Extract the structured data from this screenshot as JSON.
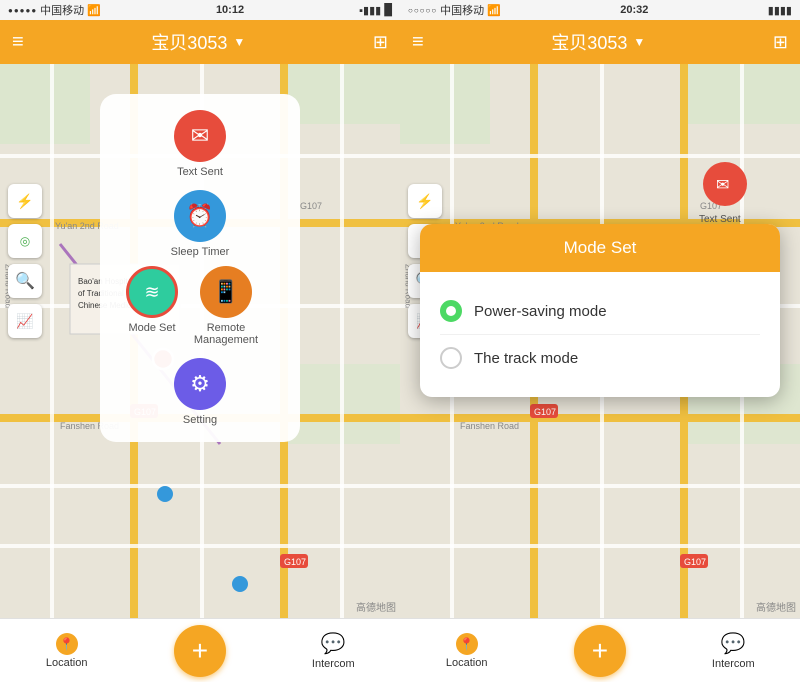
{
  "left_phone": {
    "status_bar": {
      "dots": "●●●●●",
      "carrier": "中国移动",
      "wifi": "WiFi",
      "time": "10:12",
      "battery_icon": "🔋",
      "signal": "▪▪▪▪"
    },
    "header": {
      "menu_icon": "≡",
      "title": "宝贝3053",
      "dropdown_icon": "▼",
      "grid_icon": "⊞"
    },
    "menu_items": [
      {
        "id": "text-sent",
        "label": "Text Sent",
        "color": "#e74c3c",
        "icon": "✉"
      },
      {
        "id": "sleep-timer",
        "label": "Sleep Timer",
        "color": "#3498db",
        "icon": "⏰"
      },
      {
        "id": "mode-set",
        "label": "Mode Set",
        "color": "#2ecc9e",
        "icon": "≋",
        "highlighted": true
      },
      {
        "id": "remote-management",
        "label": "Remote Management",
        "color": "#e67e22",
        "icon": "📱"
      },
      {
        "id": "setting",
        "label": "Setting",
        "color": "#6c5ce7",
        "icon": "⚙"
      }
    ],
    "map": {
      "watermark": "高德地图",
      "g107_label": "G107",
      "hospital_label": "Bao'an Hospital of Traditional Chinese Medicine"
    },
    "bottom_nav": {
      "location_label": "Location",
      "plus_icon": "+",
      "intercom_label": "Intercom",
      "chat_icon": "💬"
    }
  },
  "right_phone": {
    "status_bar": {
      "dots": "○○○○○",
      "carrier": "中国移动",
      "wifi": "WiFi",
      "time": "20:32",
      "battery_icon": "🔋"
    },
    "header": {
      "menu_icon": "≡",
      "title": "宝贝3053",
      "dropdown_icon": "▼",
      "grid_icon": "⊞"
    },
    "mode_dialog": {
      "title": "Mode Set",
      "options": [
        {
          "id": "power-saving",
          "label": "Power-saving mode",
          "selected": true
        },
        {
          "id": "track",
          "label": "The track mode",
          "selected": false
        }
      ]
    },
    "map": {
      "watermark": "高德地图",
      "g107_label": "G107"
    },
    "bottom_nav": {
      "location_label": "Location",
      "plus_icon": "+",
      "intercom_label": "Intercom",
      "chat_icon": "💬"
    }
  },
  "icons": {
    "bluetooth": "bluetooth",
    "location_pin": "📍",
    "search": "🔍",
    "track": "📈"
  }
}
